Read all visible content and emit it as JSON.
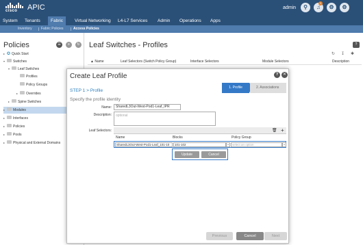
{
  "header": {
    "logo_text": "cisco",
    "app_title": "APIC",
    "user": "admin",
    "notification_count": "1",
    "icons": [
      "search-icon",
      "bell-icon",
      "settings-icon",
      "gear-icon"
    ]
  },
  "main_nav": {
    "tabs": [
      "System",
      "Tenants",
      "Fabric",
      "Virtual Networking",
      "L4-L7 Services",
      "Admin",
      "Operations",
      "Apps"
    ],
    "active": "Fabric"
  },
  "sub_nav": {
    "tabs": [
      "Inventory",
      "Fabric Policies",
      "Access Policies"
    ],
    "active": "Access Policies"
  },
  "left_pane": {
    "title": "Policies",
    "tree": [
      {
        "label": "Quick Start",
        "icon": "quick-start-icon"
      },
      {
        "label": "Switches",
        "icon": "folder-icon"
      },
      {
        "label": "Leaf Switches",
        "icon": "folder-icon"
      },
      {
        "label": "Profiles",
        "icon": "folder-icon"
      },
      {
        "label": "Policy Groups",
        "icon": "folder-icon"
      },
      {
        "label": "Overrides",
        "icon": "folder-icon"
      },
      {
        "label": "Spine Switches",
        "icon": "folder-icon"
      },
      {
        "label": "Modules",
        "icon": "folder-icon"
      },
      {
        "label": "Interfaces",
        "icon": "folder-icon"
      },
      {
        "label": "Policies",
        "icon": "folder-icon"
      },
      {
        "label": "Pools",
        "icon": "folder-icon"
      },
      {
        "label": "Physical and External Domains",
        "icon": "folder-icon"
      }
    ]
  },
  "main_pane": {
    "title": "Leaf Switches - Profiles",
    "columns": [
      "▲ Name",
      "Leaf Selectors (Switch Policy Group)",
      "Interface Selectors",
      "Module Selectors",
      "Description"
    ]
  },
  "modal": {
    "title": "Create Leaf Profile",
    "step_title": "STEP 1 > Profile",
    "wizard_steps": [
      "1. Profile",
      "2. Associations"
    ],
    "subtitle": "Specify the profile identity",
    "name_label": "Name:",
    "name_value": "SharedL3Out-West-Pod1-Leaf_IPR",
    "description_label": "Description:",
    "description_placeholder": "optional",
    "leaf_selectors_label": "Leaf Selectors:",
    "selector_columns": [
      "Name",
      "Blocks",
      "Policy Group"
    ],
    "selector_row": {
      "name": "SharedL3Out-West-Pod1-Leaf_101-10",
      "blocks": "101-102",
      "policy_group_placeholder": "select an option"
    },
    "update_label": "Update",
    "cancel_row_label": "Cancel",
    "footer": {
      "previous": "Previous",
      "cancel": "Cancel",
      "next": "Next"
    }
  }
}
